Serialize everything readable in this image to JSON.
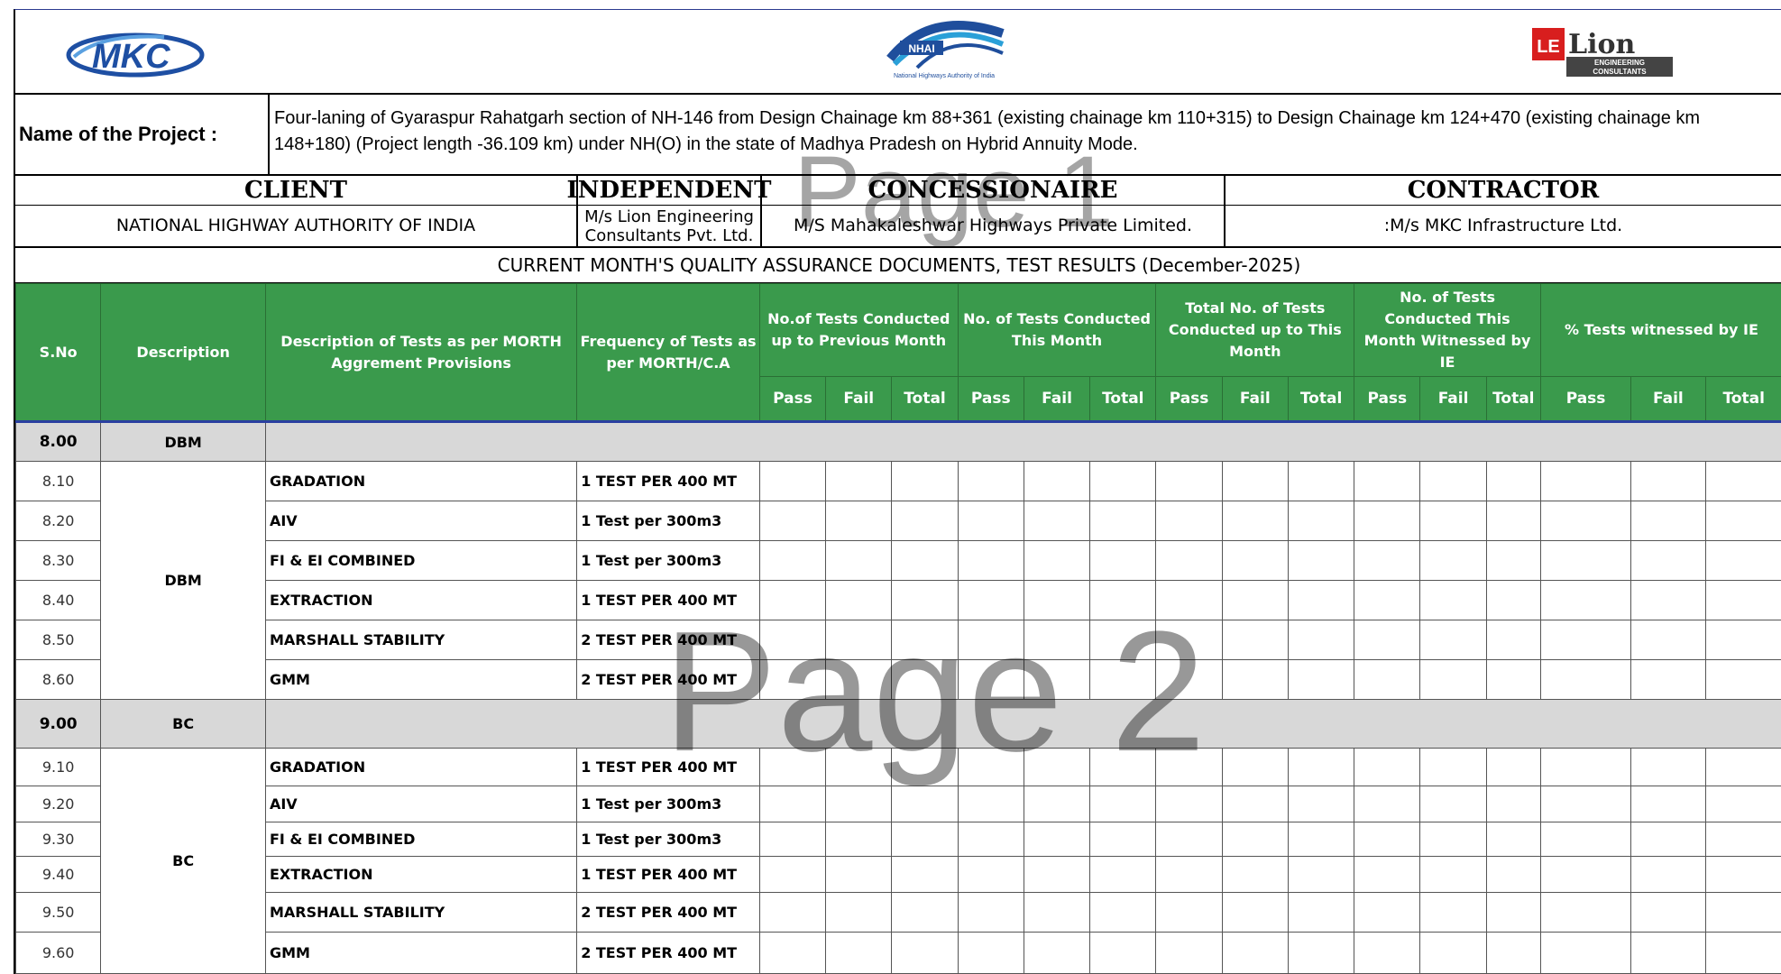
{
  "logos": {
    "mkc_text": "MKC",
    "nhai_text": "NHAI",
    "nhai_caption": "National Highways Authority of India",
    "lion_mark": "LE",
    "lion_name": "Lion",
    "lion_sub1": "ENGINEERING",
    "lion_sub2": "CONSULTANTS"
  },
  "project": {
    "label": "Name of the Project :",
    "value": "Four-laning of Gyaraspur Rahatgarh section of NH-146 from Design Chainage km 88+361 (existing chainage km 110+315) to Design Chainage km 124+470 (existing chainage km 148+180) (Project length -36.109 km) under NH(O) in the state of Madhya Pradesh on Hybrid Annuity Mode."
  },
  "parties": {
    "client": "CLIENT",
    "independent": "INDEPENDENT",
    "concessionaire": "CONCESSIONAIRE",
    "contractor": "CONTRACTOR",
    "client_name": "NATIONAL HIGHWAY AUTHORITY OF INDIA",
    "independent_name": "M/s Lion Engineering Consultants Pvt. Ltd.",
    "concessionaire_name": "M/S Mahakaleshwar Highways Private Limited.",
    "contractor_name": ":M/s MKC Infrastructure Ltd."
  },
  "doc_title": "CURRENT MONTH'S QUALITY ASSURANCE DOCUMENTS, TEST RESULTS (December-2025)",
  "table": {
    "headers": {
      "sno": "S.No",
      "description": "Description",
      "tests": "Description of Tests as per MORTH Aggrement Provisions",
      "frequency": "Frequency of Tests as per MORTH/C.A",
      "g1": "No.of Tests Conducted up to Previous Month",
      "g2": "No. of Tests Conducted This Month",
      "g3": "Total No. of Tests Conducted up to This Month",
      "g4": "No. of Tests Conducted This Month Witnessed by IE",
      "g5": "% Tests witnessed by IE",
      "pass": "Pass",
      "fail": "Fail",
      "total": "Total"
    },
    "sections": [
      {
        "sno": "8.00",
        "name": "DBM",
        "group": "DBM",
        "rows": [
          {
            "sno": "8.10",
            "test": "GRADATION",
            "freq": "1 TEST PER 400 MT"
          },
          {
            "sno": "8.20",
            "test": "AIV",
            "freq": "1 Test per 300m3"
          },
          {
            "sno": "8.30",
            "test": "FI & EI COMBINED",
            "freq": "1 Test per 300m3"
          },
          {
            "sno": "8.40",
            "test": "EXTRACTION",
            "freq": "1 TEST PER 400 MT"
          },
          {
            "sno": "8.50",
            "test": "MARSHALL STABILITY",
            "freq": "2 TEST PER 400 MT"
          },
          {
            "sno": "8.60",
            "test": "GMM",
            "freq": "2 TEST PER 400 MT"
          }
        ]
      },
      {
        "sno": "9.00",
        "name": "BC",
        "group": "BC",
        "rows": [
          {
            "sno": "9.10",
            "test": "GRADATION",
            "freq": "1 TEST PER 400 MT"
          },
          {
            "sno": "9.20",
            "test": "AIV",
            "freq": "1 Test per 300m3"
          },
          {
            "sno": "9.30",
            "test": "FI & EI COMBINED",
            "freq": "1 Test per 300m3"
          },
          {
            "sno": "9.40",
            "test": "EXTRACTION",
            "freq": "1 TEST PER 400 MT"
          },
          {
            "sno": "9.50",
            "test": "MARSHALL STABILITY",
            "freq": "2 TEST PER 400 MT"
          },
          {
            "sno": "9.60",
            "test": "GMM",
            "freq": "2 TEST PER 400 MT"
          }
        ]
      }
    ]
  },
  "watermarks": {
    "page1": "Page 1",
    "page2": "Page 2"
  },
  "colors": {
    "header_green": "#3a9a4c",
    "section_gray": "#d8d8d8",
    "rule_blue": "#2a3fa0"
  }
}
